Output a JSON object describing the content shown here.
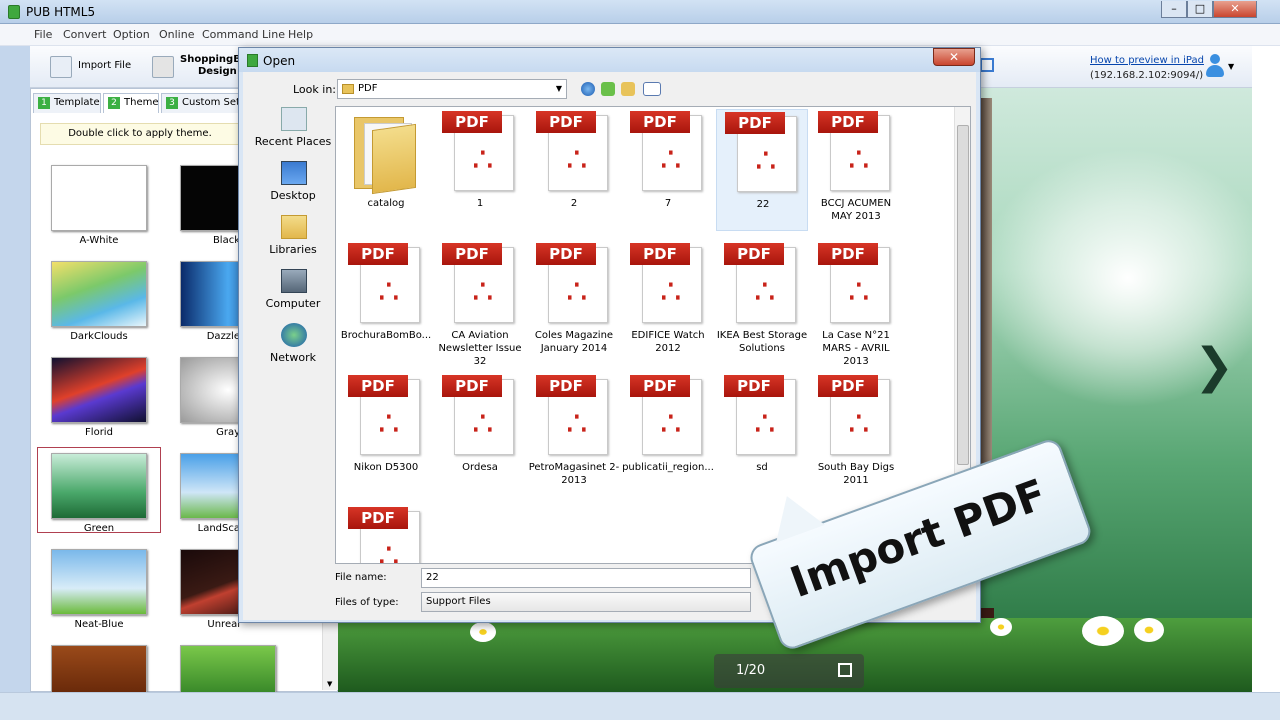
{
  "window": {
    "title": "PUB HTML5",
    "minimize": "–",
    "maximize": "□",
    "close": "✕"
  },
  "menu": [
    "File",
    "Convert",
    "Option",
    "Online",
    "Command Line",
    "Help"
  ],
  "toolbar": {
    "import_label": "Import File",
    "shopping_label_1": "ShoppingB",
    "shopping_label_2": "Design",
    "preview_link": "How to preview in iPad",
    "ip_text": "(192.168.2.102:9094/)"
  },
  "panel": {
    "tabs": [
      {
        "num": "1",
        "label": "Template"
      },
      {
        "num": "2",
        "label": "Theme"
      },
      {
        "num": "3",
        "label": "Custom Sett"
      }
    ],
    "hint": "Double click to apply theme.",
    "themes": [
      {
        "label": "A-White"
      },
      {
        "label": "Black"
      },
      {
        "label": "DarkClouds"
      },
      {
        "label": "Dazzle"
      },
      {
        "label": "Florid"
      },
      {
        "label": "Gray"
      },
      {
        "label": "Green"
      },
      {
        "label": "LandSca"
      },
      {
        "label": "Neat-Blue"
      },
      {
        "label": "Unreal"
      }
    ]
  },
  "preview": {
    "page_indicator": "1/20",
    "next_arrow": "❯"
  },
  "dialog": {
    "title": "Open",
    "close": "✕",
    "look_in_label": "Look in:",
    "look_in_value": "PDF",
    "places": [
      "Recent Places",
      "Desktop",
      "Libraries",
      "Computer",
      "Network"
    ],
    "items": [
      {
        "name": "catalog",
        "kind": "folder"
      },
      {
        "name": "1",
        "kind": "pdf"
      },
      {
        "name": "2",
        "kind": "pdf"
      },
      {
        "name": "7",
        "kind": "pdf"
      },
      {
        "name": "22",
        "kind": "pdf",
        "selected": true
      },
      {
        "name": "BCCJ ACUMEN MAY 2013",
        "kind": "pdf"
      },
      {
        "name": "BrochuraBomBo...",
        "kind": "pdf"
      },
      {
        "name": "CA Aviation Newsletter Issue 32",
        "kind": "pdf"
      },
      {
        "name": "Coles Magazine January 2014",
        "kind": "pdf"
      },
      {
        "name": "EDIFICE Watch 2012",
        "kind": "pdf"
      },
      {
        "name": "IKEA Best Storage Solutions",
        "kind": "pdf"
      },
      {
        "name": "La Case N°21 MARS - AVRIL 2013",
        "kind": "pdf"
      },
      {
        "name": "Nikon D5300",
        "kind": "pdf"
      },
      {
        "name": "Ordesa",
        "kind": "pdf"
      },
      {
        "name": "PetroMagasinet 2-2013",
        "kind": "pdf"
      },
      {
        "name": "publicatii_region...",
        "kind": "pdf"
      },
      {
        "name": "sd",
        "kind": "pdf"
      },
      {
        "name": "South Bay Digs 2011",
        "kind": "pdf"
      },
      {
        "name": "",
        "kind": "pdf"
      }
    ],
    "pdf_badge": "PDF",
    "file_name_label": "File name:",
    "file_name_value": "22",
    "file_type_label": "Files of type:",
    "file_type_value": "Support Files"
  },
  "callout": {
    "text": "Import PDF"
  }
}
